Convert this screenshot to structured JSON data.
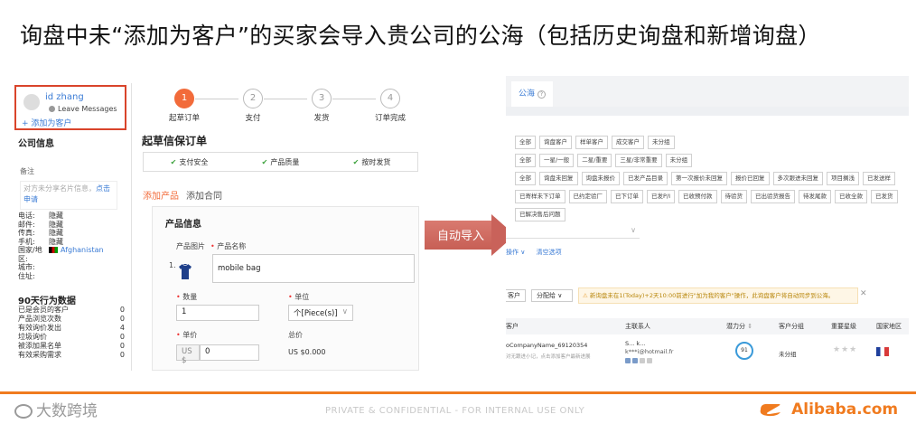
{
  "slide_title": "询盘中未“添加为客户”的买家会导入贵公司的公海（包括历史询盘和新增询盘）",
  "left_panel": {
    "profile": {
      "name": "id zhang",
      "leave_messages": "Leave Messages",
      "add_customer": "+ 添加为客户"
    },
    "company_info_title": "公司信息",
    "note_label": "备注",
    "note_placeholder": "对方未分享名片信息，",
    "note_link": "点击申请",
    "info_rows": [
      {
        "label": "电话:",
        "value": "隐藏"
      },
      {
        "label": "邮件:",
        "value": "隐藏"
      },
      {
        "label": "传真:",
        "value": "隐藏"
      },
      {
        "label": "手机:",
        "value": "隐藏"
      },
      {
        "label": "国家/地区:",
        "value": "Afghanistan"
      },
      {
        "label": "城市:",
        "value": ""
      },
      {
        "label": "住址:",
        "value": ""
      }
    ],
    "behavior_title": "90天行为数据",
    "stats": [
      {
        "label": "已是会员的客户",
        "value": "0"
      },
      {
        "label": "产品浏览次数",
        "value": "0"
      },
      {
        "label": "有效询价发出",
        "value": "4"
      },
      {
        "label": "垃圾询价",
        "value": "0"
      },
      {
        "label": "被添加黑名单",
        "value": "0"
      },
      {
        "label": "有效采购需求",
        "value": "0"
      }
    ],
    "steps": [
      {
        "num": "1",
        "label": "起草订单",
        "active": true
      },
      {
        "num": "2",
        "label": "支付",
        "active": false
      },
      {
        "num": "3",
        "label": "发货",
        "active": false
      },
      {
        "num": "4",
        "label": "订单完成",
        "active": false
      }
    ],
    "order_title": "起草信保订单",
    "guarantees": [
      "支付安全",
      "产品质量",
      "按时发货"
    ],
    "subtabs": [
      "添加产品",
      "添加合同"
    ],
    "product_info_title": "产品信息",
    "product_image_label": "产品图片",
    "product_name_label": "产品名称",
    "product_index": "1.",
    "product_name_value": "mobile bag",
    "quantity_label": "数量",
    "quantity_value": "1",
    "unit_label": "单位",
    "unit_value": "个[Piece(s)]",
    "unit_price_label": "单价",
    "currency": "US $",
    "unit_price_value": "0",
    "total_label": "总价",
    "total_value": "US $0.000"
  },
  "arrow_label": "自动导入",
  "right_panel": {
    "tab_label": "公海",
    "filter_rows": [
      [
        "全部",
        "询盘客户",
        "样单客户",
        "成交客户",
        "未分组"
      ],
      [
        "全部",
        "一星/一般",
        "二星/重要",
        "三星/非常重要",
        "未分组"
      ],
      [
        "全部",
        "询盘未回复",
        "询盘未报价",
        "已发产品目录",
        "第一次报价未回复",
        "报价已回复",
        "多次跟进未回复",
        "项目搁浅",
        "已发送样"
      ],
      [
        "已寄样未下订单",
        "已约定验厂",
        "已下订单",
        "已发P/I",
        "已收预付款",
        "待验货",
        "已出验货报告",
        "待发尾款",
        "已收全款",
        "已发货"
      ],
      [
        "已解决售后问题"
      ]
    ],
    "ops": [
      "操作 ∨",
      "清空选项"
    ],
    "toolbar": {
      "btn1": "客户",
      "btn2": "分配给 ∨"
    },
    "notice": "新询盘未在1(Today)+2天10:00前进行\"加为我的客户\"操作，此询盘客户将自动同步到公海。",
    "table_headers": [
      "客户",
      "主联系人",
      "潜力分",
      "客户分组",
      "重要星级",
      "国家地区"
    ],
    "row": {
      "company": "oCompanyName_69120354",
      "company_sub": "对无跟进小记，点击添加客户最新进展",
      "contact": "S... k...",
      "contact_email": "k***i@hotmail.fr",
      "score": "91",
      "group": "未分组",
      "stars": "★★★"
    }
  },
  "footer": {
    "confidential": "PRIVATE & CONFIDENTIAL - FOR INTERNAL USE ONLY",
    "watermark": "大数跨境",
    "brand": "Alibaba.com"
  },
  "colors": {
    "accent_orange": "#f07b1f",
    "step_active": "#f26b3a",
    "link_blue": "#3a7bd5",
    "highlight_red": "#d9442b",
    "arrow_red": "#c9625a"
  }
}
